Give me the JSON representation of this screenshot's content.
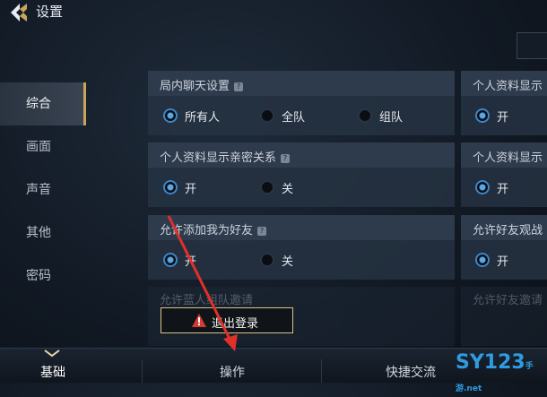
{
  "header": {
    "title": "设置"
  },
  "sidebar": {
    "items": [
      "综合",
      "画面",
      "声音",
      "其他",
      "密码"
    ],
    "active": "综合"
  },
  "panels": {
    "chat": {
      "title": "局内聊天设置",
      "options": [
        "所有人",
        "全队",
        "组队"
      ],
      "selected": "所有人"
    },
    "profile_right": {
      "title": "个人资料显示",
      "options": [
        "开"
      ],
      "selected": "开"
    },
    "intimacy": {
      "title": "个人资料显示亲密关系",
      "options": [
        "开",
        "关"
      ],
      "selected": "开"
    },
    "profile_right2": {
      "title": "个人资料显示",
      "options": [
        "开"
      ],
      "selected": "开"
    },
    "add_friend": {
      "title": "允许添加我为好友",
      "options": [
        "开",
        "关"
      ],
      "selected": "开"
    },
    "watch": {
      "title": "允许好友观战",
      "options": [
        "开"
      ],
      "selected": "开"
    },
    "faded_left": "允许蓝人组队邀请",
    "faded_right": "允许好友邀请"
  },
  "logout": {
    "label": "退出登录"
  },
  "bottom_tabs": [
    "基础",
    "操作",
    "快捷交流"
  ],
  "bottom_active": "基础",
  "watermark": {
    "text": "SY123",
    "suffix": "手游",
    "dot": ".net"
  },
  "colors": {
    "accent": "#c9a55a",
    "radio_on": "#3f86c7",
    "annotation": "#e0302a"
  }
}
